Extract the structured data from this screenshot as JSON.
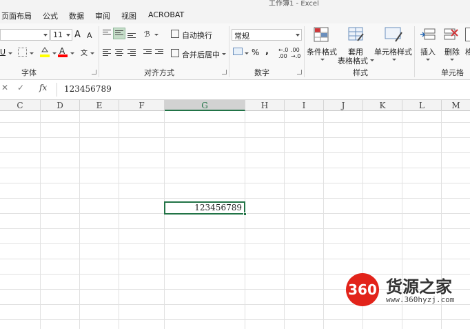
{
  "title": "工作簿1 - Excel",
  "menu_tabs": [
    "页面布局",
    "公式",
    "数据",
    "审阅",
    "视图",
    "ACROBAT"
  ],
  "ribbon": {
    "font_size": "11",
    "grow_font": "A",
    "shrink_font": "A",
    "underline": "U",
    "font_color_letter": "A",
    "phonetic": "文",
    "wrap_text": "自动换行",
    "merge_center": "合并后居中",
    "number_format": "常规",
    "percent": "%",
    "comma": ",",
    "inc_decimal": "←.0\n.00",
    "dec_decimal": ".00\n→.0",
    "conditional_format": "条件格式",
    "table_format_1": "套用",
    "table_format_2": "表格格式",
    "cell_styles": "单元格样式",
    "insert": "插入",
    "delete": "删除",
    "format_partial": "格",
    "groups": {
      "font": "字体",
      "alignment": "对齐方式",
      "number": "数字",
      "styles": "样式",
      "cells": "单元格"
    }
  },
  "formula_bar": {
    "cancel": "✕",
    "enter": "✓",
    "fx": "fx",
    "content": "123456789"
  },
  "columns": [
    "C",
    "D",
    "E",
    "F",
    "G",
    "H",
    "I",
    "J",
    "K",
    "L",
    "M"
  ],
  "selected_column": "G",
  "selected_cell_value": "123456789",
  "watermark": {
    "badge": "360",
    "brand": "货源之家",
    "url": "www.360hyzj.com"
  },
  "colors": {
    "excel_green": "#217346",
    "watermark_red": "#e2231a",
    "fill_yellow": "#ffff00",
    "font_red": "#ff0000"
  }
}
